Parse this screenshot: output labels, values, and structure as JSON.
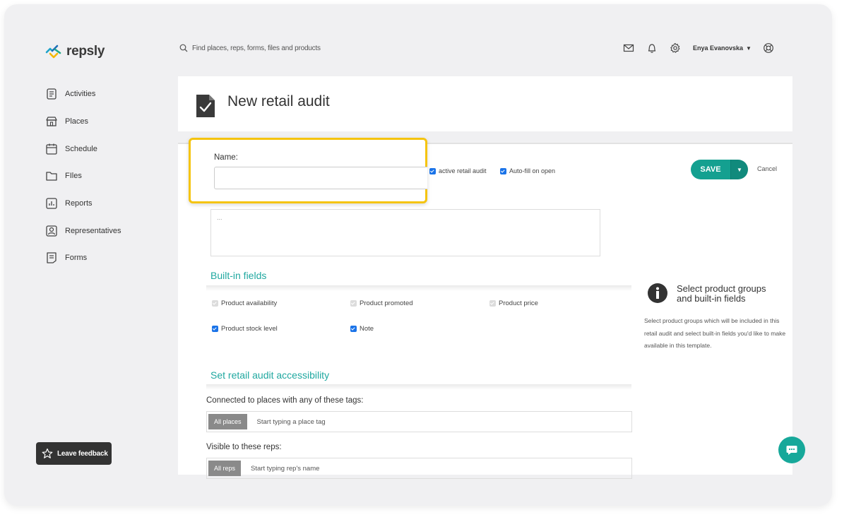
{
  "app": {
    "brand": "repsly"
  },
  "colors": {
    "accent": "#14a090",
    "highlight": "#f5c40f",
    "checkbox": "#1a73e8"
  },
  "search": {
    "placeholder": "Find places, reps, forms, files and products"
  },
  "user": {
    "name": "Enya Evanovska"
  },
  "sidebar": {
    "items": [
      {
        "label": "Activities",
        "icon": "activities-icon"
      },
      {
        "label": "Places",
        "icon": "store-icon"
      },
      {
        "label": "Schedule",
        "icon": "calendar-icon"
      },
      {
        "label": "FIles",
        "icon": "folder-icon"
      },
      {
        "label": "Reports",
        "icon": "report-icon"
      },
      {
        "label": "Representatives",
        "icon": "person-icon"
      },
      {
        "label": "Forms",
        "icon": "form-icon"
      }
    ]
  },
  "feedback": {
    "label": "Leave feedback"
  },
  "page": {
    "title": "New retail audit"
  },
  "form": {
    "name_label": "Name:",
    "active_label": "active retail audit",
    "autofill_label": "Auto-fill on open",
    "description_placeholder": "...",
    "save_label": "SAVE",
    "cancel_label": "Cancel"
  },
  "builtin": {
    "title": "Built-in fields",
    "fields": [
      {
        "label": "Product availability",
        "state": "disabled"
      },
      {
        "label": "Product promoted",
        "state": "disabled"
      },
      {
        "label": "Product price",
        "state": "disabled"
      },
      {
        "label": "Product stock level",
        "state": "checked"
      },
      {
        "label": "Note",
        "state": "checked"
      }
    ]
  },
  "info": {
    "title": "Select product groups and built-in fields",
    "text": "Select product groups which will be included in this retail audit and select built-in fields you'd like to make available in this template."
  },
  "accessibility": {
    "title": "Set retail audit accessibility",
    "places_label": "Connected to places with any of these tags:",
    "places_chip": "All places",
    "places_placeholder": "Start typing a place tag",
    "reps_label": "Visible to these reps:",
    "reps_chip": "All reps",
    "reps_placeholder": "Start typing rep's name"
  }
}
